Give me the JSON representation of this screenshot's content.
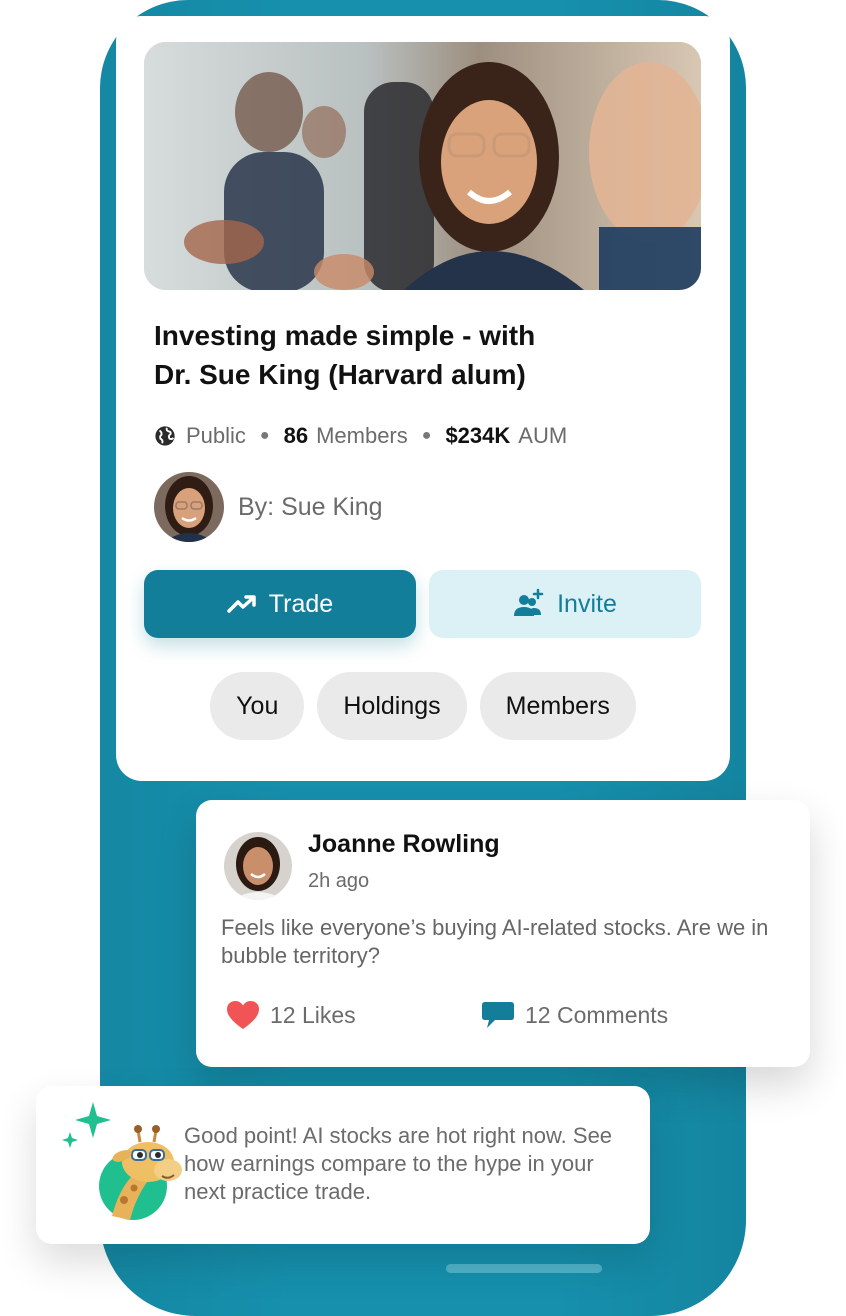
{
  "group": {
    "title_line1": "Investing made simple - with",
    "title_line2": "Dr. Sue King (Harvard alum)",
    "visibility": "Public",
    "members_count": "86",
    "members_label": "Members",
    "aum_value": "$234K",
    "aum_label": "AUM",
    "author": "By: Sue King",
    "trade_label": "Trade",
    "invite_label": "Invite",
    "tabs": [
      "You",
      "Holdings",
      "Members"
    ]
  },
  "post": {
    "author": "Joanne Rowling",
    "time": "2h ago",
    "body": "Feels like everyone’s buying AI-related stocks. Are we in bubble territory?",
    "likes": "12 Likes",
    "comments": "12 Comments"
  },
  "assistant": {
    "message": "Good point! AI stocks are hot right now. See how earnings compare to the hype in your next practice trade."
  },
  "colors": {
    "brand": "#137e99",
    "phone": "#1690ad",
    "invite_bg": "#dcf1f6",
    "like_heart": "#f05454",
    "mascot_circle": "#1fbf8f"
  },
  "icons": [
    "globe-icon",
    "trending-up-icon",
    "add-user-icon",
    "heart-icon",
    "comment-icon",
    "sparkle-icon"
  ]
}
